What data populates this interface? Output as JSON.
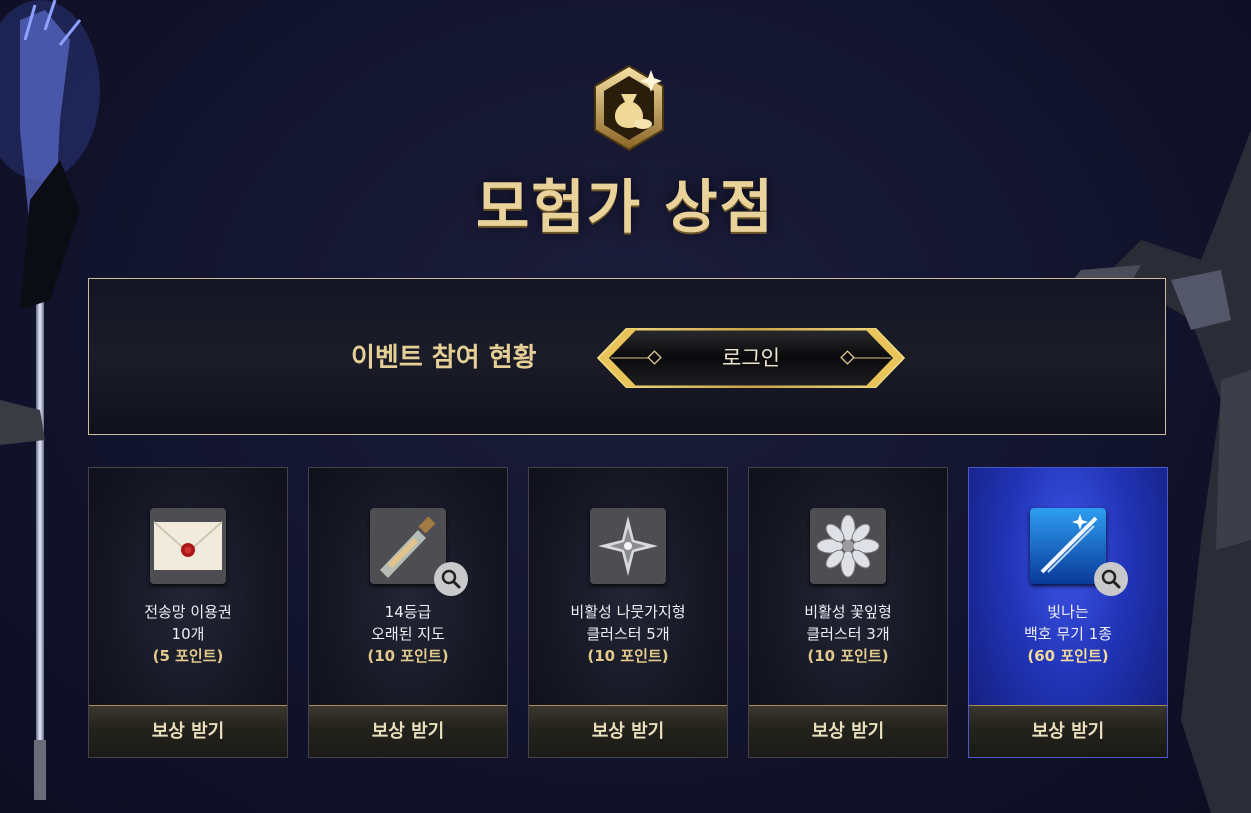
{
  "header": {
    "title": "모험가 상점",
    "emblem_icon": "coin-pouch-icon"
  },
  "status": {
    "label": "이벤트 참여 현황",
    "login_label": "로그인"
  },
  "cards": [
    {
      "name_line1": "전송망 이용권",
      "name_line2": "10개",
      "points": "(5 포인트)",
      "icon": "sealed-letter-icon",
      "claim_label": "보상 받기",
      "zoom": false
    },
    {
      "name_line1": "14등급",
      "name_line2": "오래된 지도",
      "points": "(10 포인트)",
      "icon": "message-bottle-icon",
      "claim_label": "보상 받기",
      "zoom": true
    },
    {
      "name_line1": "비활성 나뭇가지형",
      "name_line2": "클러스터 5개",
      "points": "(10 포인트)",
      "icon": "branch-cluster-icon",
      "claim_label": "보상 받기",
      "zoom": false
    },
    {
      "name_line1": "비활성 꽃잎형",
      "name_line2": "클러스터 3개",
      "points": "(10 포인트)",
      "icon": "petal-cluster-icon",
      "claim_label": "보상 받기",
      "zoom": false
    },
    {
      "name_line1": "빛나는",
      "name_line2": "백호 무기 1종",
      "points": "(60 포인트)",
      "icon": "glowing-weapon-icon",
      "claim_label": "보상 받기",
      "zoom": true
    }
  ],
  "colors": {
    "gold": "#e4cf97",
    "background": "#141530",
    "highlight_card": "#2033b5"
  }
}
